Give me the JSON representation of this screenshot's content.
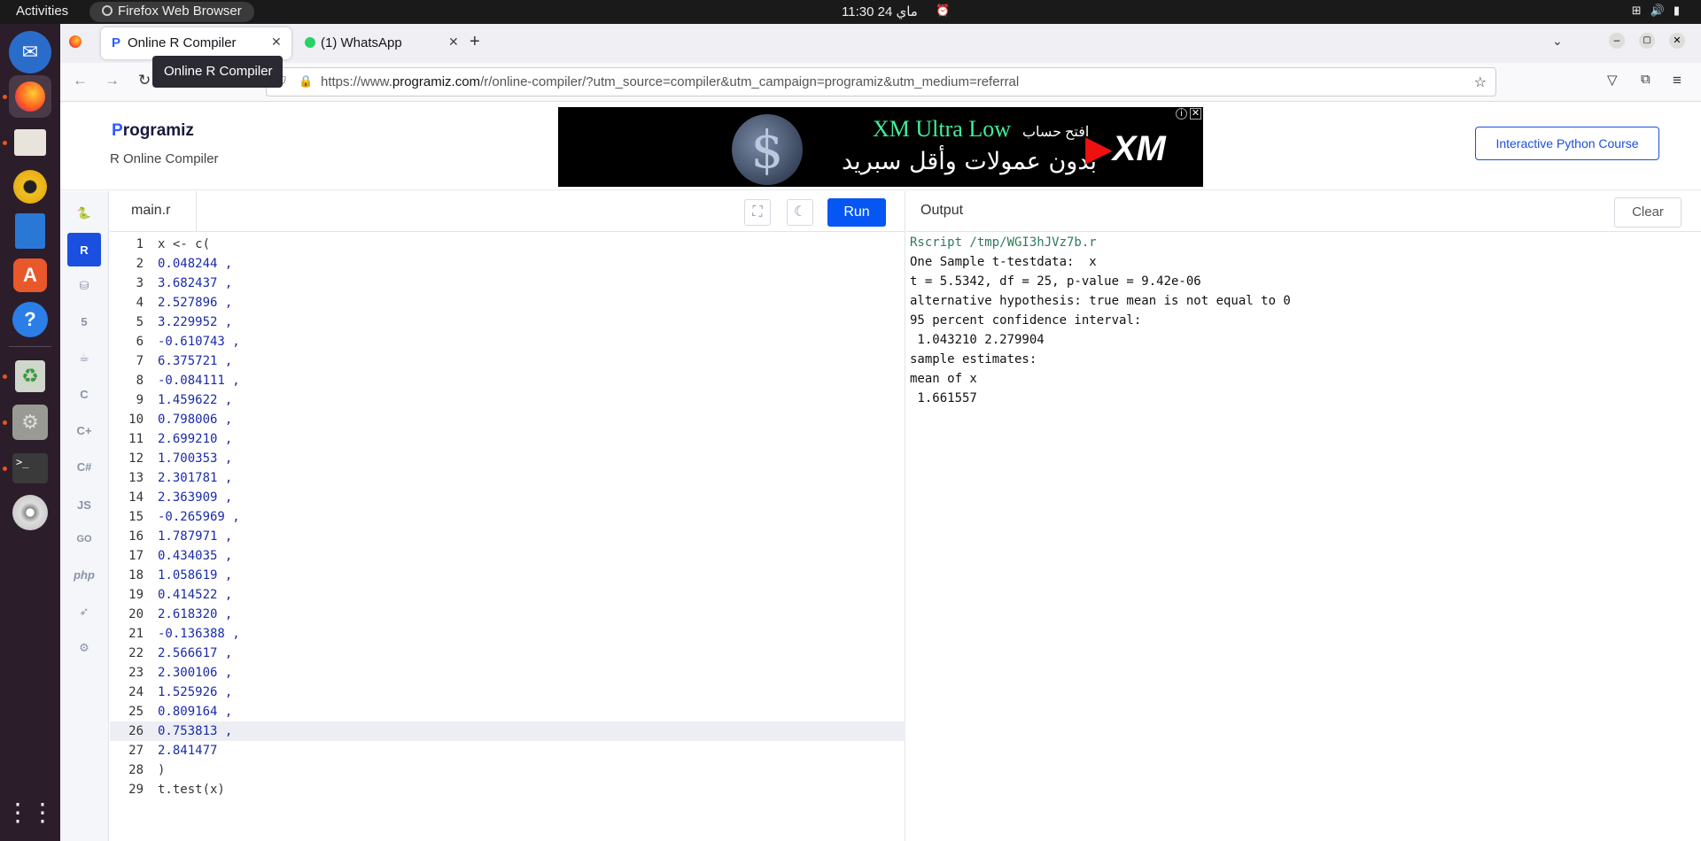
{
  "topbar": {
    "activities": "Activities",
    "app_name": "Firefox Web Browser",
    "clock": "ماي 24  11:30"
  },
  "dock": {
    "items": [
      "thunderbird-icon",
      "firefox-icon",
      "files-icon",
      "rhythmbox-icon",
      "writer-icon",
      "app-center-icon",
      "help-icon",
      "trash-icon",
      "settings-icon",
      "terminal-icon",
      "disc-icon",
      "show-apps-icon"
    ]
  },
  "browser": {
    "tabs": [
      {
        "label": "Online R Compiler",
        "active": true
      },
      {
        "label": "(1) WhatsApp",
        "active": false
      }
    ],
    "tooltip": "Online R Compiler",
    "url_prefix": "https://www.",
    "url_domain": "programiz.com",
    "url_path": "/r/online-compiler/?utm_source=compiler&utm_campaign=programiz&utm_medium=referral"
  },
  "page": {
    "logo_text": "rogramiz",
    "logo_p": "P",
    "subtitle": "R Online Compiler",
    "ad": {
      "line1_en": "XM Ultra Low",
      "line1_ar": "افتح حساب",
      "line2": "بدون عمولات وأقل سبريد",
      "brand": "XM"
    },
    "cta": "Interactive Python Course"
  },
  "languages": [
    "python",
    "r",
    "sql",
    "html",
    "java",
    "c",
    "cpp",
    "csharp",
    "js",
    "go",
    "php",
    "swift",
    "rust"
  ],
  "editor": {
    "file_name": "main.r",
    "run_label": "Run",
    "lines": [
      {
        "n": "1",
        "text": "x <- c("
      },
      {
        "n": "2",
        "text": "0.048244 ,"
      },
      {
        "n": "3",
        "text": "3.682437 ,"
      },
      {
        "n": "4",
        "text": "2.527896 ,"
      },
      {
        "n": "5",
        "text": "3.229952 ,"
      },
      {
        "n": "6",
        "text": "-0.610743 ,"
      },
      {
        "n": "7",
        "text": "6.375721 ,"
      },
      {
        "n": "8",
        "text": "-0.084111 ,"
      },
      {
        "n": "9",
        "text": "1.459622 ,"
      },
      {
        "n": "10",
        "text": "0.798006 ,"
      },
      {
        "n": "11",
        "text": "2.699210 ,"
      },
      {
        "n": "12",
        "text": "1.700353 ,"
      },
      {
        "n": "13",
        "text": "2.301781 ,"
      },
      {
        "n": "14",
        "text": "2.363909 ,"
      },
      {
        "n": "15",
        "text": "-0.265969 ,"
      },
      {
        "n": "16",
        "text": "1.787971 ,"
      },
      {
        "n": "17",
        "text": "0.434035 ,"
      },
      {
        "n": "18",
        "text": "1.058619 ,"
      },
      {
        "n": "19",
        "text": "0.414522 ,"
      },
      {
        "n": "20",
        "text": "2.618320 ,"
      },
      {
        "n": "21",
        "text": "-0.136388 ,"
      },
      {
        "n": "22",
        "text": "2.566617 ,"
      },
      {
        "n": "23",
        "text": "2.300106 ,"
      },
      {
        "n": "24",
        "text": "1.525926 ,"
      },
      {
        "n": "25",
        "text": "0.809164 ,"
      },
      {
        "n": "26",
        "text": "0.753813 ,",
        "highlight": true
      },
      {
        "n": "27",
        "text": "2.841477"
      },
      {
        "n": "28",
        "text": ")"
      },
      {
        "n": "29",
        "text": "t.test(x)"
      }
    ]
  },
  "output": {
    "title": "Output",
    "clear_label": "Clear",
    "lines": [
      {
        "text": "Rscript /tmp/WGI3hJVz7b.r",
        "cmd": true
      },
      {
        "text": "One Sample t-testdata:  x"
      },
      {
        "text": "t = 5.5342, df = 25, p-value = 9.42e-06"
      },
      {
        "text": "alternative hypothesis: true mean is not equal to 0"
      },
      {
        "text": "95 percent confidence interval:"
      },
      {
        "text": " 1.043210 2.279904"
      },
      {
        "text": "sample estimates:"
      },
      {
        "text": "mean of x"
      },
      {
        "text": " 1.661557"
      }
    ]
  },
  "colors": {
    "accent": "#0556f3",
    "dock_bg": "#2c1d2a",
    "topbar_bg": "#1a1a1a"
  }
}
